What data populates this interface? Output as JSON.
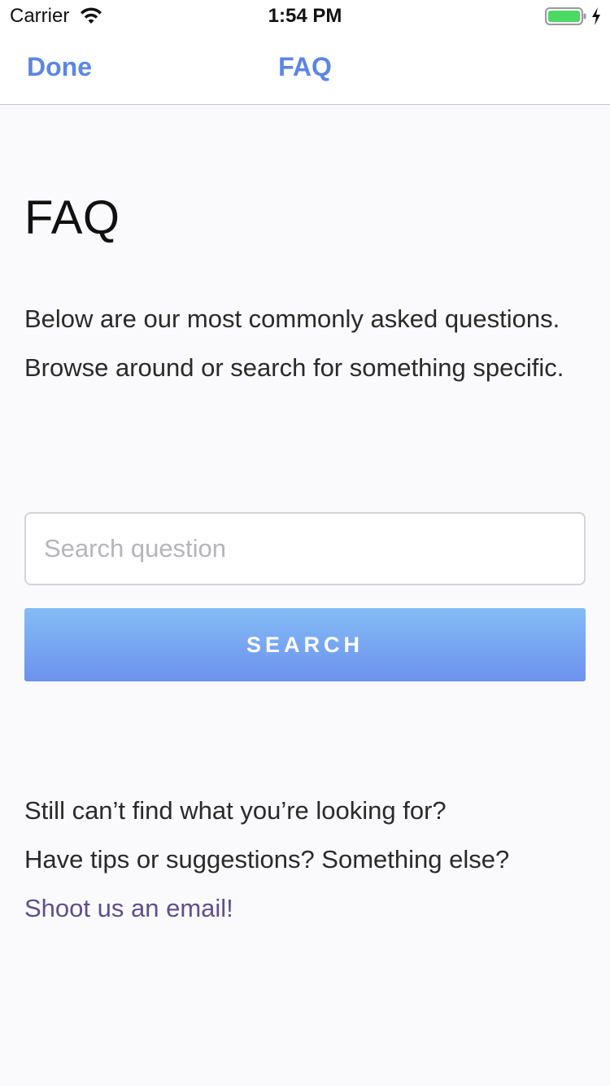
{
  "status_bar": {
    "carrier": "Carrier",
    "time": "1:54 PM",
    "wifi_icon": "wifi-icon",
    "battery_icon": "battery-icon",
    "battery_color": "#4cd964"
  },
  "nav": {
    "done_label": "Done",
    "title": "FAQ",
    "accent_color": "#5b86e5"
  },
  "page": {
    "heading": "FAQ",
    "intro_line1": "Below are our most commonly asked questions.",
    "intro_line2": "Browse around or search for something specific."
  },
  "search": {
    "placeholder": "Search question",
    "value": "",
    "button_label": "SEARCH"
  },
  "footer": {
    "line1": "Still can’t find what you’re looking for?",
    "line2": "Have tips or suggestions? Something else?",
    "email_link": "Shoot us an email!",
    "link_color": "#5e4f8f"
  }
}
